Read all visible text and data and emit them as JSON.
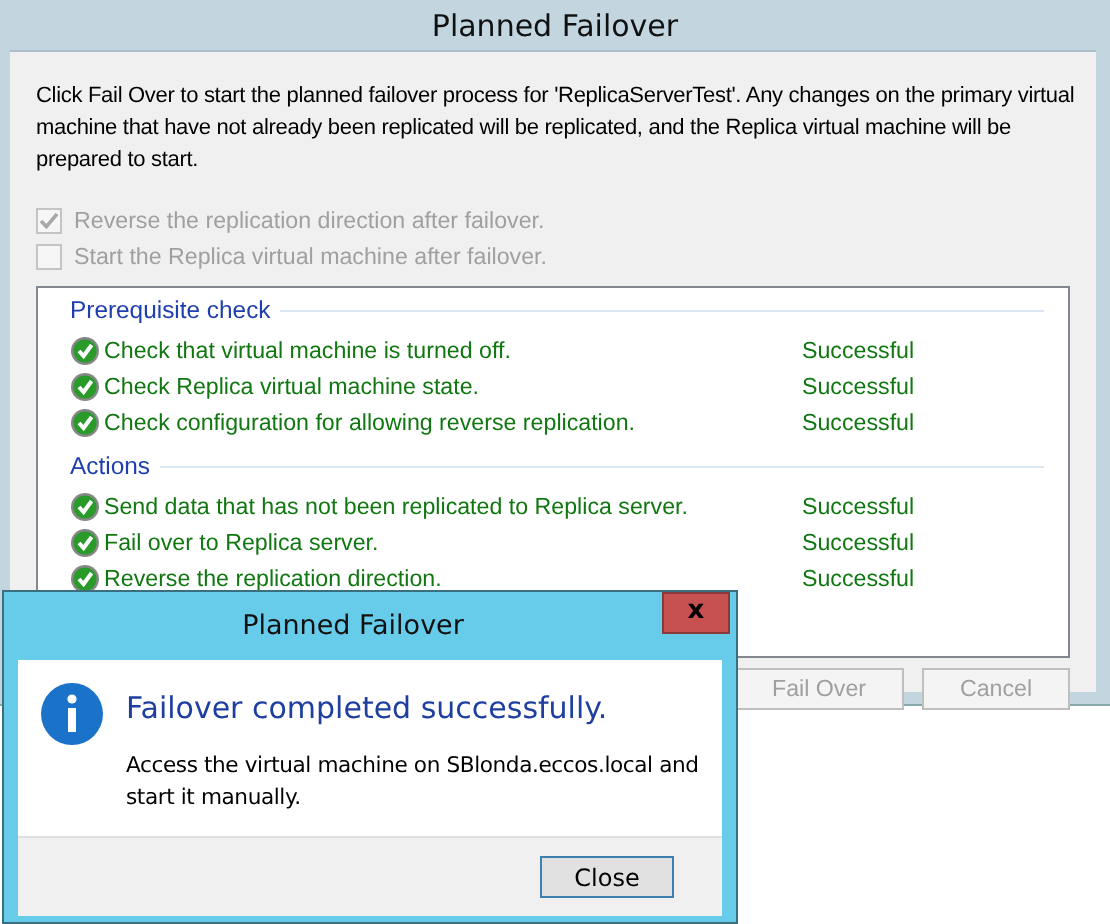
{
  "window": {
    "title": "Planned Failover"
  },
  "description": "Click Fail Over to start the planned failover process for 'ReplicaServerTest'. Any changes on the primary virtual machine that have not already been replicated will be replicated, and the Replica virtual machine will be prepared to start.",
  "options": [
    {
      "label": "Reverse the replication direction after failover.",
      "checked": true,
      "disabled": true
    },
    {
      "label": "Start the Replica virtual machine after failover.",
      "checked": false,
      "disabled": true
    }
  ],
  "sections": [
    {
      "title": "Prerequisite check",
      "steps": [
        {
          "text": "Check that virtual machine is turned off.",
          "status": "Successful",
          "kind": "success"
        },
        {
          "text": "Check Replica virtual machine state.",
          "status": "Successful",
          "kind": "success"
        },
        {
          "text": "Check configuration for allowing reverse replication.",
          "status": "Successful",
          "kind": "success"
        }
      ]
    },
    {
      "title": "Actions",
      "steps": [
        {
          "text": "Send data that has not been replicated to Replica server.",
          "status": "Successful",
          "kind": "success"
        },
        {
          "text": "Fail over to Replica server.",
          "status": "Successful",
          "kind": "success"
        },
        {
          "text": "Reverse the replication direction.",
          "status": "Successful",
          "kind": "success"
        }
      ]
    }
  ],
  "buttons": [
    {
      "label": "Fail Over",
      "disabled": true
    },
    {
      "label": "Cancel",
      "disabled": true
    }
  ],
  "dialog": {
    "title": "Planned Failover",
    "close_icon": "x",
    "heading": "Failover completed successfully.",
    "message": "Access the virtual machine on SBlonda.eccos.local and start it manually.",
    "buttons": [
      {
        "label": "Close"
      }
    ]
  }
}
